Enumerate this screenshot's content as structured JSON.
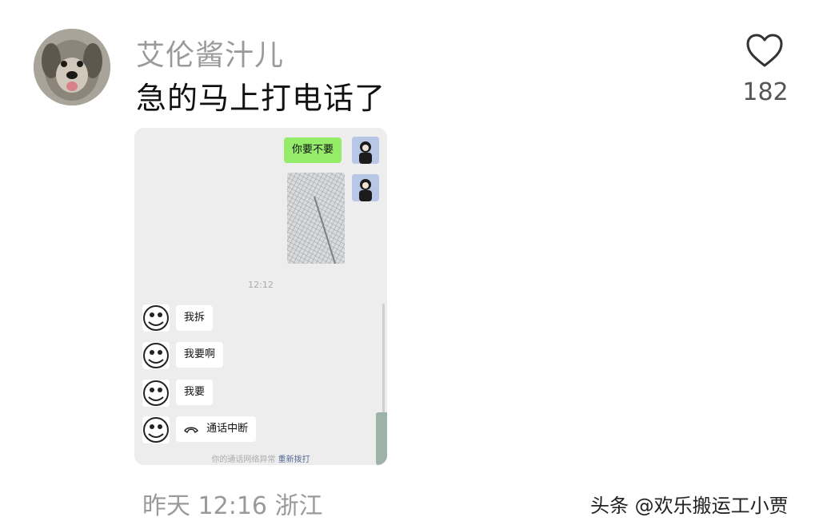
{
  "comment": {
    "username": "艾伦酱汁儿",
    "text": "急的马上打电话了",
    "likes": "182",
    "meta": {
      "day": "昨天",
      "time": "12:16",
      "location": "浙江"
    }
  },
  "chat_screenshot": {
    "messages_top": [
      {
        "side": "me",
        "type": "text",
        "text": "你要不要"
      },
      {
        "side": "me",
        "type": "image"
      }
    ],
    "timestamp": "12:12",
    "messages_bottom": [
      {
        "side": "other",
        "type": "text",
        "text": "我拆"
      },
      {
        "side": "other",
        "type": "text",
        "text": "我要啊"
      },
      {
        "side": "other",
        "type": "text",
        "text": "我要"
      },
      {
        "side": "other",
        "type": "call",
        "text": "通话中断",
        "icon": "phone-hangup-icon"
      }
    ],
    "notice": {
      "text": "你的通话网络异常",
      "action": "重新拨打"
    }
  },
  "watermark": "头条 @欢乐搬运工小贾",
  "colors": {
    "my_bubble": "#95ec69",
    "other_bubble": "#ffffff",
    "chat_bg": "#ededed",
    "link": "#576b95"
  }
}
